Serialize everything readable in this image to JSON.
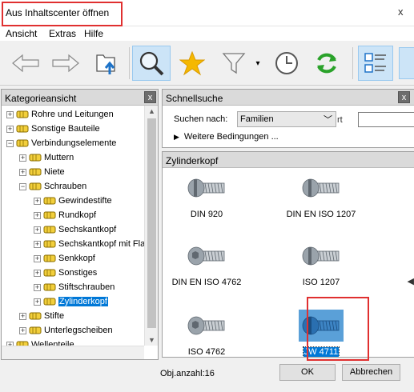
{
  "window": {
    "title": "Aus Inhaltscenter öffnen",
    "close_glyph": "x"
  },
  "menu": [
    "Ansicht",
    "Extras",
    "Hilfe"
  ],
  "toolbar": {
    "icons": [
      "back-arrow-icon",
      "forward-arrow-icon",
      "folder-up-icon",
      "search-icon",
      "favorites-star-icon",
      "filter-icon",
      "history-clock-icon",
      "refresh-icon",
      "view-list-icon"
    ],
    "active": "search-icon",
    "dropdown_glyph": "▾"
  },
  "category_view": {
    "title": "Kategorieansicht",
    "close_glyph": "x",
    "items": [
      {
        "label": "Rohre und Leitungen",
        "level": 0,
        "expanded": false
      },
      {
        "label": "Sonstige Bauteile",
        "level": 0,
        "expanded": false
      },
      {
        "label": "Verbindungselemente",
        "level": 0,
        "expanded": true
      },
      {
        "label": "Muttern",
        "level": 1,
        "expanded": false
      },
      {
        "label": "Niete",
        "level": 1,
        "expanded": false
      },
      {
        "label": "Schrauben",
        "level": 1,
        "expanded": true
      },
      {
        "label": "Gewindestifte",
        "level": 2,
        "expanded": false
      },
      {
        "label": "Rundkopf",
        "level": 2,
        "expanded": false
      },
      {
        "label": "Sechskantkopf",
        "level": 2,
        "expanded": false
      },
      {
        "label": "Sechskantkopf mit Fla",
        "level": 2,
        "expanded": false
      },
      {
        "label": "Senkkopf",
        "level": 2,
        "expanded": false
      },
      {
        "label": "Sonstiges",
        "level": 2,
        "expanded": false
      },
      {
        "label": "Stiftschrauben",
        "level": 2,
        "expanded": false
      },
      {
        "label": "Zylinderkopf",
        "level": 2,
        "expanded": false,
        "selected": true
      },
      {
        "label": "Stifte",
        "level": 1,
        "expanded": false
      },
      {
        "label": "Unterlegscheiben",
        "level": 1,
        "expanded": false
      },
      {
        "label": "Wellenteile",
        "level": 0,
        "expanded": false
      }
    ]
  },
  "quick_search": {
    "title": "Schnellsuche",
    "close_glyph": "x",
    "search_by_label": "Suchen nach:",
    "search_by_value": "Familien",
    "cut_label": "rt",
    "more_conditions": "Weitere Bedingungen ..."
  },
  "results": {
    "title": "Zylinderkopf",
    "items": [
      {
        "label": "DIN 920",
        "type": "slotted"
      },
      {
        "label": "DIN EN ISO 1207",
        "type": "slotted"
      },
      {
        "label": "DIN EN ISO 4762",
        "type": "socket"
      },
      {
        "label": "ISO 1207",
        "type": "slotted"
      },
      {
        "label": "ISO 4762",
        "type": "socket"
      },
      {
        "label": "JW 4711",
        "type": "slotted",
        "selected": true
      }
    ]
  },
  "footer": {
    "count_label": "Obj.anzahl:",
    "count": "16",
    "ok": "OK",
    "cancel": "Abbrechen"
  }
}
